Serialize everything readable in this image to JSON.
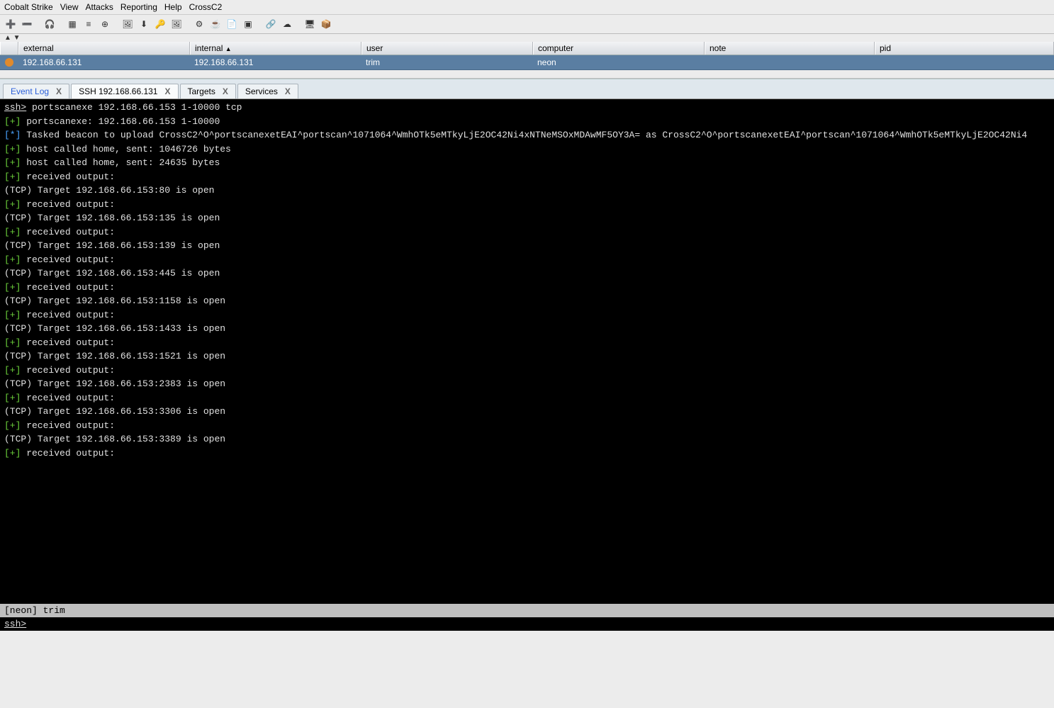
{
  "menu": {
    "items": [
      "Cobalt Strike",
      "View",
      "Attacks",
      "Reporting",
      "Help",
      "CrossC2"
    ]
  },
  "toolbar": {
    "icons": [
      "plus-icon",
      "minus-icon",
      "sep",
      "headphones-icon",
      "sep",
      "grid-icon",
      "list-icon",
      "crosshair-icon",
      "sep",
      "image-icon",
      "download-icon",
      "key-icon",
      "picture-icon",
      "sep",
      "gear-icon",
      "cup-icon",
      "document-icon",
      "terminal-icon",
      "sep",
      "link-icon",
      "cloud-icon",
      "sep",
      "screen-icon",
      "cube-icon"
    ]
  },
  "smallctrl": "▲  ▼",
  "beacons": {
    "headers": {
      "external": "external",
      "internal": "internal",
      "internal_sort": "▲",
      "user": "user",
      "computer": "computer",
      "note": "note",
      "pid": "pid"
    },
    "rows": [
      {
        "external": "192.168.66.131",
        "internal": "192.168.66.131",
        "user": "trim",
        "computer": "neon",
        "note": "",
        "pid": ""
      }
    ]
  },
  "tabs": [
    {
      "label": "Event Log",
      "active": false,
      "blue": true
    },
    {
      "label": "SSH 192.168.66.131",
      "active": true,
      "blue": false
    },
    {
      "label": "Targets",
      "active": false,
      "blue": false
    },
    {
      "label": "Services",
      "active": false,
      "blue": false
    }
  ],
  "console": {
    "prompt": "ssh>",
    "command": " portscanexe 192.168.66.153 1-10000 tcp",
    "lines": [
      {
        "prefix": "[+]",
        "cls": "pre-green",
        "text": " portscanexe: 192.168.66.153 1-10000"
      },
      {
        "prefix": "[*]",
        "cls": "pre-star",
        "text": " Tasked beacon to upload CrossC2^O^portscanexetEAI^portscan^1071064^WmhOTk5eMTkyLjE2OC42Ni4xNTNeMSOxMDAwMF5OY3A= as CrossC2^O^portscanexetEAI^portscan^1071064^WmhOTk5eMTkyLjE2OC42Ni4"
      },
      {
        "prefix": "[+]",
        "cls": "pre-green",
        "text": " host called home, sent: 1046726 bytes"
      },
      {
        "prefix": "[+]",
        "cls": "pre-green",
        "text": " host called home, sent: 24635 bytes"
      },
      {
        "prefix": "[+]",
        "cls": "pre-green",
        "text": " received output:"
      },
      {
        "prefix": "",
        "cls": "",
        "text": "(TCP) Target 192.168.66.153:80 is open"
      },
      {
        "prefix": "",
        "cls": "",
        "text": ""
      },
      {
        "prefix": "[+]",
        "cls": "pre-green",
        "text": " received output:"
      },
      {
        "prefix": "",
        "cls": "",
        "text": "(TCP) Target 192.168.66.153:135 is open"
      },
      {
        "prefix": "",
        "cls": "",
        "text": ""
      },
      {
        "prefix": "[+]",
        "cls": "pre-green",
        "text": " received output:"
      },
      {
        "prefix": "",
        "cls": "",
        "text": "(TCP) Target 192.168.66.153:139 is open"
      },
      {
        "prefix": "",
        "cls": "",
        "text": ""
      },
      {
        "prefix": "[+]",
        "cls": "pre-green",
        "text": " received output:"
      },
      {
        "prefix": "",
        "cls": "",
        "text": "(TCP) Target 192.168.66.153:445 is open"
      },
      {
        "prefix": "",
        "cls": "",
        "text": ""
      },
      {
        "prefix": "[+]",
        "cls": "pre-green",
        "text": " received output:"
      },
      {
        "prefix": "",
        "cls": "",
        "text": "(TCP) Target 192.168.66.153:1158 is open"
      },
      {
        "prefix": "",
        "cls": "",
        "text": ""
      },
      {
        "prefix": "[+]",
        "cls": "pre-green",
        "text": " received output:"
      },
      {
        "prefix": "",
        "cls": "",
        "text": "(TCP) Target 192.168.66.153:1433 is open"
      },
      {
        "prefix": "",
        "cls": "",
        "text": ""
      },
      {
        "prefix": "[+]",
        "cls": "pre-green",
        "text": " received output:"
      },
      {
        "prefix": "",
        "cls": "",
        "text": "(TCP) Target 192.168.66.153:1521 is open"
      },
      {
        "prefix": "",
        "cls": "",
        "text": ""
      },
      {
        "prefix": "[+]",
        "cls": "pre-green",
        "text": " received output:"
      },
      {
        "prefix": "",
        "cls": "",
        "text": "(TCP) Target 192.168.66.153:2383 is open"
      },
      {
        "prefix": "",
        "cls": "",
        "text": ""
      },
      {
        "prefix": "[+]",
        "cls": "pre-green",
        "text": " received output:"
      },
      {
        "prefix": "",
        "cls": "",
        "text": "(TCP) Target 192.168.66.153:3306 is open"
      },
      {
        "prefix": "",
        "cls": "",
        "text": ""
      },
      {
        "prefix": "[+]",
        "cls": "pre-green",
        "text": " received output:"
      },
      {
        "prefix": "",
        "cls": "",
        "text": "(TCP) Target 192.168.66.153:3389 is open"
      },
      {
        "prefix": "",
        "cls": "",
        "text": ""
      },
      {
        "prefix": "[+]",
        "cls": "pre-green",
        "text": " received output:"
      }
    ]
  },
  "status_line": "[neon] trim",
  "input_prompt": "ssh>",
  "icon_glyphs": {
    "plus-icon": "➕",
    "minus-icon": "➖",
    "headphones-icon": "🎧",
    "grid-icon": "▦",
    "list-icon": "≡",
    "crosshair-icon": "⊕",
    "image-icon": "🖼",
    "download-icon": "⬇",
    "key-icon": "🔑",
    "picture-icon": "🖼",
    "gear-icon": "⚙",
    "cup-icon": "☕",
    "document-icon": "📄",
    "terminal-icon": "▣",
    "link-icon": "🔗",
    "cloud-icon": "☁",
    "screen-icon": "🖥",
    "cube-icon": "📦"
  }
}
